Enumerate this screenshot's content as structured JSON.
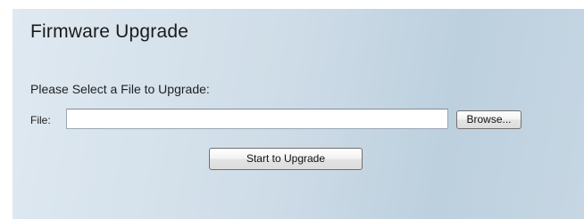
{
  "page": {
    "title": "Firmware Upgrade"
  },
  "upgrade_form": {
    "instruction": "Please Select a File to Upgrade:",
    "file_label": "File:",
    "file_value": "",
    "browse_label": "Browse...",
    "start_label": "Start to Upgrade"
  }
}
